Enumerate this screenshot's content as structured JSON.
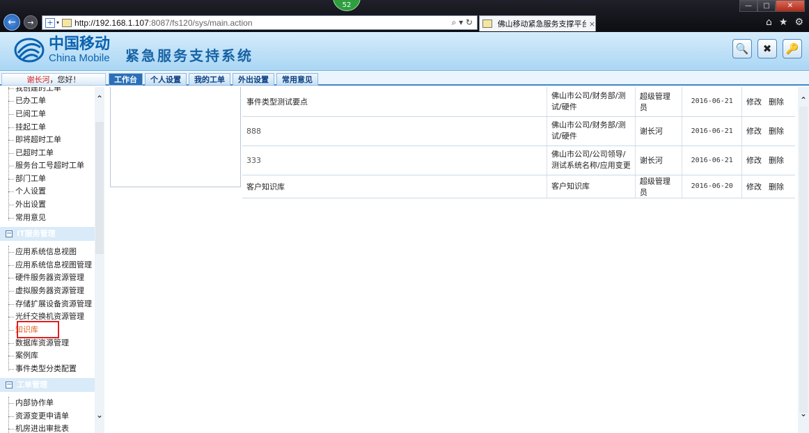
{
  "browser": {
    "tab_count": "52",
    "url_host": "http://192.168.1.107",
    "url_path": ":8087/fs120/sys/main.action",
    "tab_title": "佛山移动紧急服务支撑平台...",
    "tab_close": "×",
    "window_min": "—",
    "window_max": "□",
    "window_close": "✕"
  },
  "header": {
    "logo_cn": "中国移动",
    "logo_en": "China Mobile",
    "system_title": "紧急服务支持系统"
  },
  "greeting": {
    "user": "谢长河",
    "suffix": "，您好！"
  },
  "tabs": [
    {
      "label": "工作台"
    },
    {
      "label": "个人设置"
    },
    {
      "label": "我的工单"
    },
    {
      "label": "外出设置"
    },
    {
      "label": "常用意见"
    }
  ],
  "sidebar": {
    "top_items": [
      {
        "label": "我创建的工单"
      },
      {
        "label": "已办工单"
      },
      {
        "label": "已阅工单"
      },
      {
        "label": "挂起工单"
      },
      {
        "label": "即将超时工单"
      },
      {
        "label": "已超时工单"
      },
      {
        "label": "服务台工号超时工单"
      },
      {
        "label": "部门工单"
      },
      {
        "label": "个人设置"
      },
      {
        "label": "外出设置"
      },
      {
        "label": "常用意见"
      }
    ],
    "section_it": "IT服务管理",
    "it_items": [
      {
        "label": "应用系统信息视图"
      },
      {
        "label": "应用系统信息视图管理"
      },
      {
        "label": "硬件服务器资源管理"
      },
      {
        "label": "虚拟服务器资源管理"
      },
      {
        "label": "存储扩展设备资源管理"
      },
      {
        "label": "光纤交换机资源管理"
      },
      {
        "label": "知识库"
      },
      {
        "label": "数据库资源管理"
      },
      {
        "label": "案例库"
      },
      {
        "label": "事件类型分类配置"
      }
    ],
    "section_wo": "工单管理",
    "wo_items": [
      {
        "label": "内部协作单"
      },
      {
        "label": "资源变更申请单"
      },
      {
        "label": "机房进出审批表"
      }
    ]
  },
  "table": {
    "rows": [
      {
        "title": "事件类型测试要点",
        "dept": "佛山市公司/财务部/测试/硬件",
        "user": "超级管理员",
        "date": "2016-06-21",
        "edit": "修改",
        "delete": "删除"
      },
      {
        "title": "888",
        "dept": "佛山市公司/财务部/测试/硬件",
        "user": "谢长河",
        "date": "2016-06-21",
        "edit": "修改",
        "delete": "删除"
      },
      {
        "title": "333",
        "dept": "佛山市公司/公司领导/测试系统名称/应用变更",
        "user": "谢长河",
        "date": "2016-06-21",
        "edit": "修改",
        "delete": "删除"
      },
      {
        "title": "客户知识库",
        "dept": "客户知识库",
        "user": "超级管理员",
        "date": "2016-06-20",
        "edit": "修改",
        "delete": "删除"
      }
    ]
  },
  "icons": {
    "search": "search-icon",
    "settings": "tools-icon",
    "logout": "key-icon"
  },
  "colors": {
    "header_bg": "#a9d6f4",
    "tab_active": "#2a6fb8",
    "highlight": "#e02020",
    "brand": "#0a63b0"
  }
}
